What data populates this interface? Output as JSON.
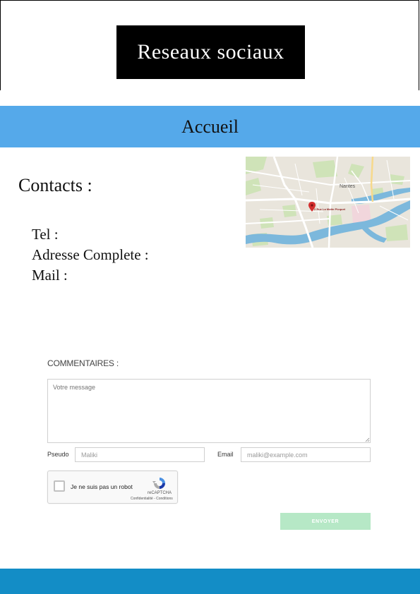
{
  "header": {
    "logo_text": "Reseaux sociaux"
  },
  "nav": {
    "home_label": "Accueil"
  },
  "contacts": {
    "title": "Contacts :",
    "tel_label": "Tel :",
    "address_label": "Adresse Complete :",
    "mail_label": "Mail :"
  },
  "map": {
    "city_label": "Nantes",
    "marker_label": "2 Rue La Motte Picquet",
    "marker_color": "#d32f2f"
  },
  "form": {
    "comments_label": "COMMENTAIRES :",
    "message_placeholder": "Votre message",
    "pseudo_label": "Pseudo",
    "pseudo_placeholder": "Maliki",
    "email_label": "Email",
    "email_placeholder": "maliki@example.com",
    "captcha_text": "Je ne suis pas un robot",
    "captcha_brand": "reCAPTCHA",
    "captcha_links": "Confidentialité - Conditions",
    "submit_label": "ENVOYER"
  },
  "colors": {
    "nav_bg": "#55a9ea",
    "footer_bg": "#138dc6",
    "submit_bg": "#b6e8c6",
    "logo_bg": "#000000"
  }
}
